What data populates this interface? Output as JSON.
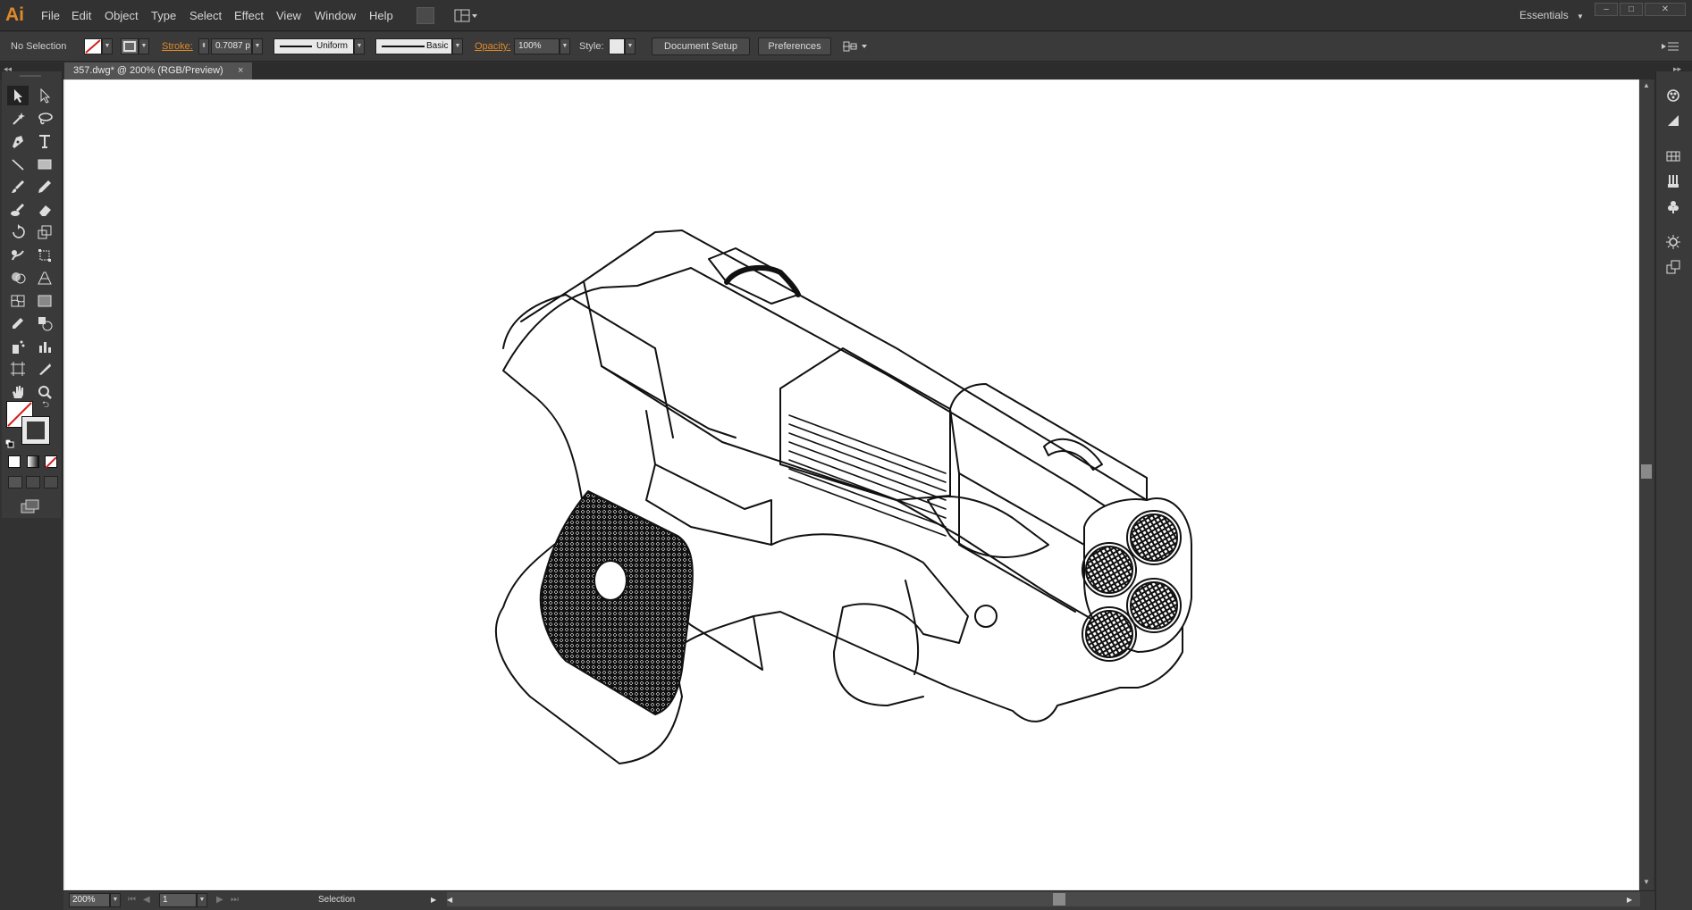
{
  "app": {
    "logo": "Ai"
  },
  "menu": [
    "File",
    "Edit",
    "Object",
    "Type",
    "Select",
    "Effect",
    "View",
    "Window",
    "Help"
  ],
  "workspace": {
    "label": "Essentials"
  },
  "window_controls": [
    "–",
    "□",
    "✕"
  ],
  "control_bar": {
    "selection": "No Selection",
    "stroke_label": "Stroke:",
    "stroke_value": "0.7087 p",
    "profile": "Uniform",
    "brush": "Basic",
    "opacity_label": "Opacity:",
    "opacity_value": "100%",
    "style_label": "Style:",
    "document_setup": "Document Setup",
    "preferences": "Preferences"
  },
  "document_tab": {
    "title": "357.dwg* @ 200% (RGB/Preview)",
    "close": "×"
  },
  "status_bar": {
    "zoom": "200%",
    "artboard": "1",
    "tool": "Selection"
  },
  "icons": {
    "tools": [
      "selection-tool-icon",
      "direct-selection-tool-icon",
      "magic-wand-tool-icon",
      "lasso-tool-icon",
      "pen-tool-icon",
      "type-tool-icon",
      "line-tool-icon",
      "rectangle-tool-icon",
      "paintbrush-tool-icon",
      "pencil-tool-icon",
      "blob-brush-tool-icon",
      "eraser-tool-icon",
      "rotate-tool-icon",
      "scale-tool-icon",
      "warp-tool-icon",
      "free-transform-tool-icon",
      "shape-builder-tool-icon",
      "perspective-grid-tool-icon",
      "mesh-tool-icon",
      "gradient-tool-icon",
      "eyedropper-tool-icon",
      "blend-tool-icon",
      "symbol-sprayer-tool-icon",
      "column-graph-tool-icon",
      "artboard-tool-icon",
      "slice-tool-icon",
      "hand-tool-icon",
      "zoom-tool-icon"
    ],
    "dock": [
      "color-panel-icon",
      "color-guide-icon",
      "swatches-icon",
      "brushes-icon",
      "symbols-icon",
      "appearance-icon",
      "layers-icon"
    ]
  },
  "colors": {
    "accent": "#e0892a",
    "ui_dark": "#323232",
    "artboard": "#ffffff",
    "stroke_none": "#d22020"
  }
}
